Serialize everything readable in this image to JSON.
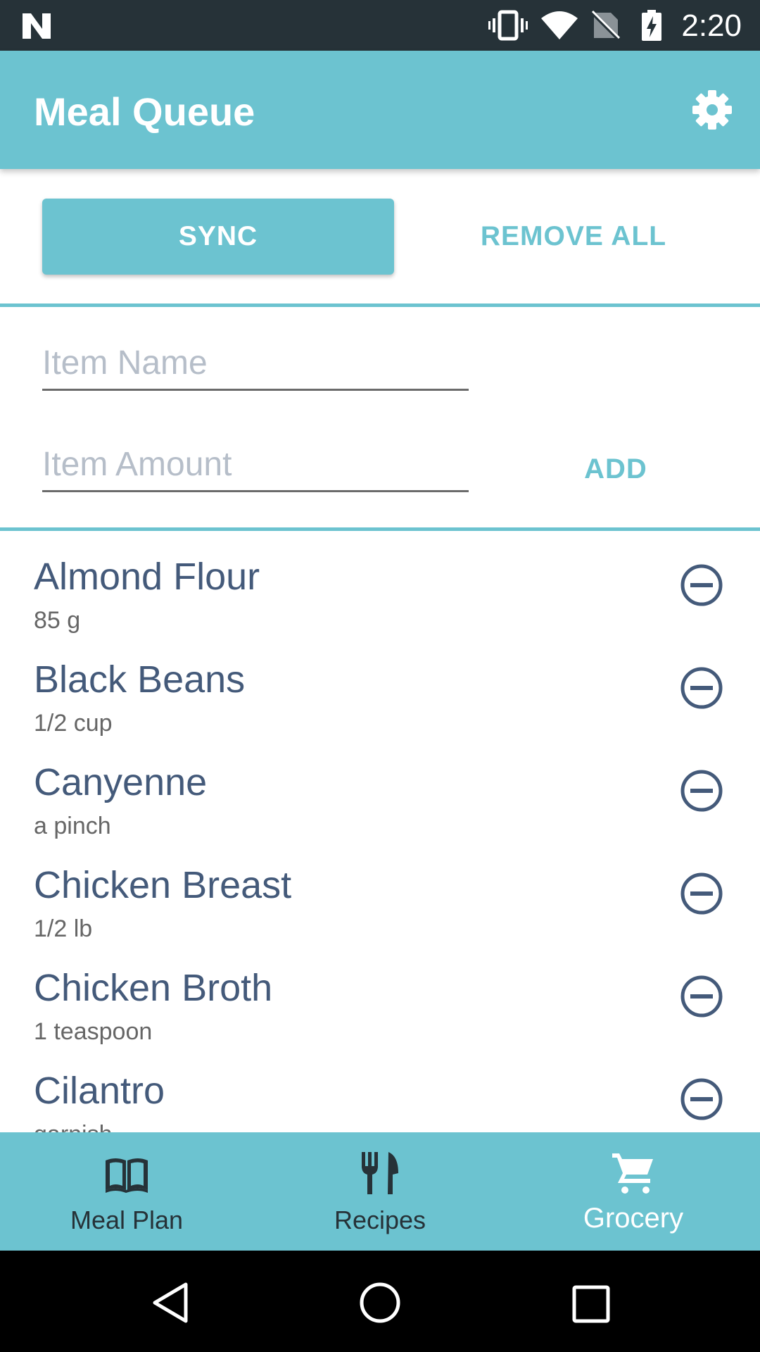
{
  "status_bar": {
    "time": "2:20"
  },
  "app_bar": {
    "title": "Meal Queue"
  },
  "actions": {
    "sync_label": "SYNC",
    "remove_all_label": "REMOVE ALL"
  },
  "form": {
    "item_name": {
      "placeholder": "Item Name",
      "value": ""
    },
    "item_amount": {
      "placeholder": "Item Amount",
      "value": ""
    },
    "add_label": "ADD"
  },
  "grocery_list": [
    {
      "name": "Almond Flour",
      "amount": "85 g"
    },
    {
      "name": "Black Beans",
      "amount": "1/2 cup"
    },
    {
      "name": "Canyenne",
      "amount": "a pinch"
    },
    {
      "name": "Chicken Breast",
      "amount": "1/2 lb"
    },
    {
      "name": "Chicken Broth",
      "amount": "1 teaspoon"
    },
    {
      "name": "Cilantro",
      "amount": "garnish"
    }
  ],
  "bottom_nav": {
    "tabs": [
      {
        "label": "Meal Plan",
        "icon": "book-icon"
      },
      {
        "label": "Recipes",
        "icon": "fork-knife-icon"
      },
      {
        "label": "Grocery",
        "icon": "cart-icon",
        "active": true
      }
    ]
  },
  "colors": {
    "accent": "#6cc3d0",
    "status_bar": "#263238",
    "item_text": "#445a7a",
    "nav_bar": "#000000"
  }
}
